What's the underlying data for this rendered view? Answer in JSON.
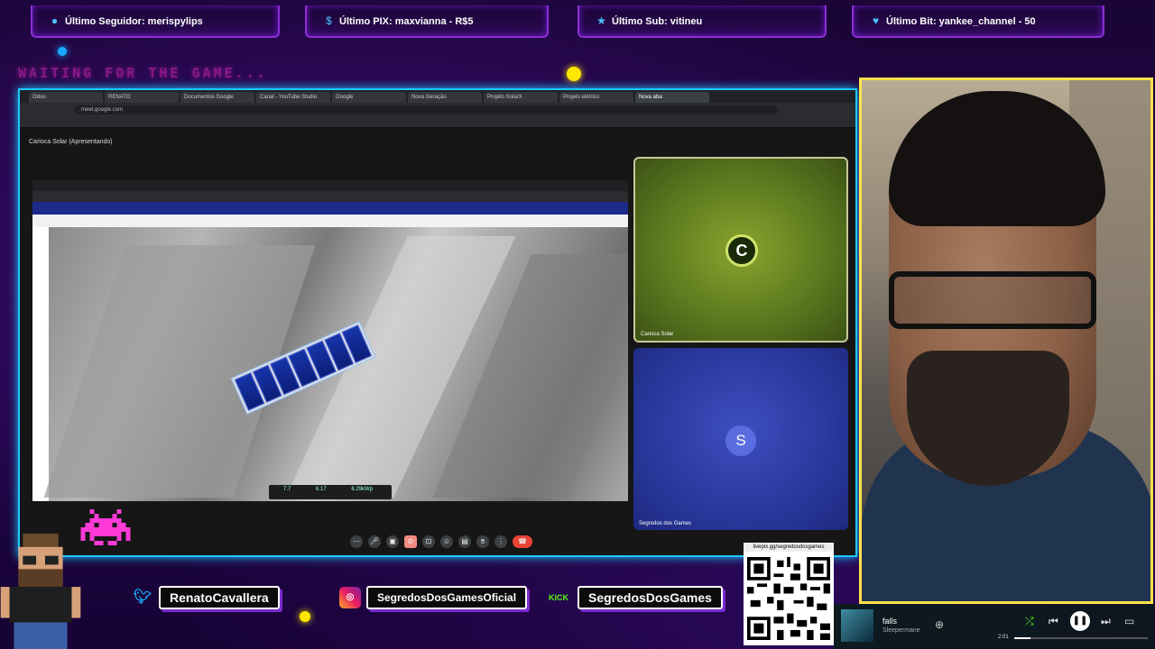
{
  "top_bar": {
    "follower": "Último Seguidor: merispylips",
    "pix": "Último PIX: maxvianna - R$5",
    "sub": "Último Sub: vitineu",
    "bit": "Último Bit: yankee_channel - 50"
  },
  "waiting_text": "WAITING FOR THE GAME...",
  "browser": {
    "tabs": [
      "Odoo",
      "RENATO",
      "Documentos Google",
      "Canal - YouTube Studio",
      "Google",
      "Nova Geração",
      "Projeto SolarX",
      "Projeto elétrico",
      "Nova aba"
    ],
    "address": "meet.google.com"
  },
  "meet": {
    "title": "Carioca Solar (Apresentando)",
    "stats": {
      "a": "7.7",
      "b": "6.17",
      "c": "6.29kWp"
    },
    "participant_a": "Carioca Solar",
    "participant_b_initial": "S",
    "participant_b": "Segredos dos Games"
  },
  "socials": {
    "twitter": "RenatoCavallera",
    "instagram": "SegredosDosGamesOficial",
    "kick_logo": "KICK",
    "kick": "SegredosDosGames"
  },
  "qr": {
    "url": "livepix.gg/segredosdosgames"
  },
  "music": {
    "title": "falls",
    "artist": "Sleepermane",
    "time": "2:01",
    "progress": 0.12
  },
  "colors": {
    "accent": "#8a2fd6",
    "neon_blue": "#1ec8ff",
    "webcam_border": "#ffe14a",
    "kick_green": "#53fc18"
  },
  "icons": [
    "user-icon",
    "dollar-icon",
    "star-icon",
    "heart-icon",
    "twitter-icon",
    "instagram-icon",
    "kick-icon",
    "shuffle-icon",
    "prev-icon",
    "pause-icon",
    "next-icon",
    "cast-icon",
    "add-icon"
  ]
}
